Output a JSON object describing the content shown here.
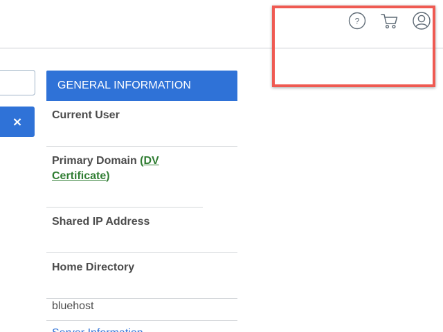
{
  "topbar": {
    "icons": [
      "help-icon",
      "cart-icon",
      "user-account-icon"
    ],
    "help_glyph": "?"
  },
  "search": {
    "value": "",
    "placeholder": ""
  },
  "clear_button": {
    "glyph": "×"
  },
  "general_info": {
    "title": "GENERAL INFORMATION",
    "rows": [
      {
        "label": "Current User"
      },
      {
        "label_prefix": "Primary Domain ",
        "link_open": "(",
        "link_text": "DV Certificate",
        "link_close": ")"
      },
      {
        "label": "Shared IP Address"
      },
      {
        "label": "Home Directory"
      }
    ],
    "value_text": "bluehost",
    "server_info_link": "Server Information"
  },
  "colors": {
    "accent": "#2f72d7",
    "highlight_border": "#ef5a52",
    "link_green": "#2f7d32",
    "divider": "#d3d6d9"
  }
}
